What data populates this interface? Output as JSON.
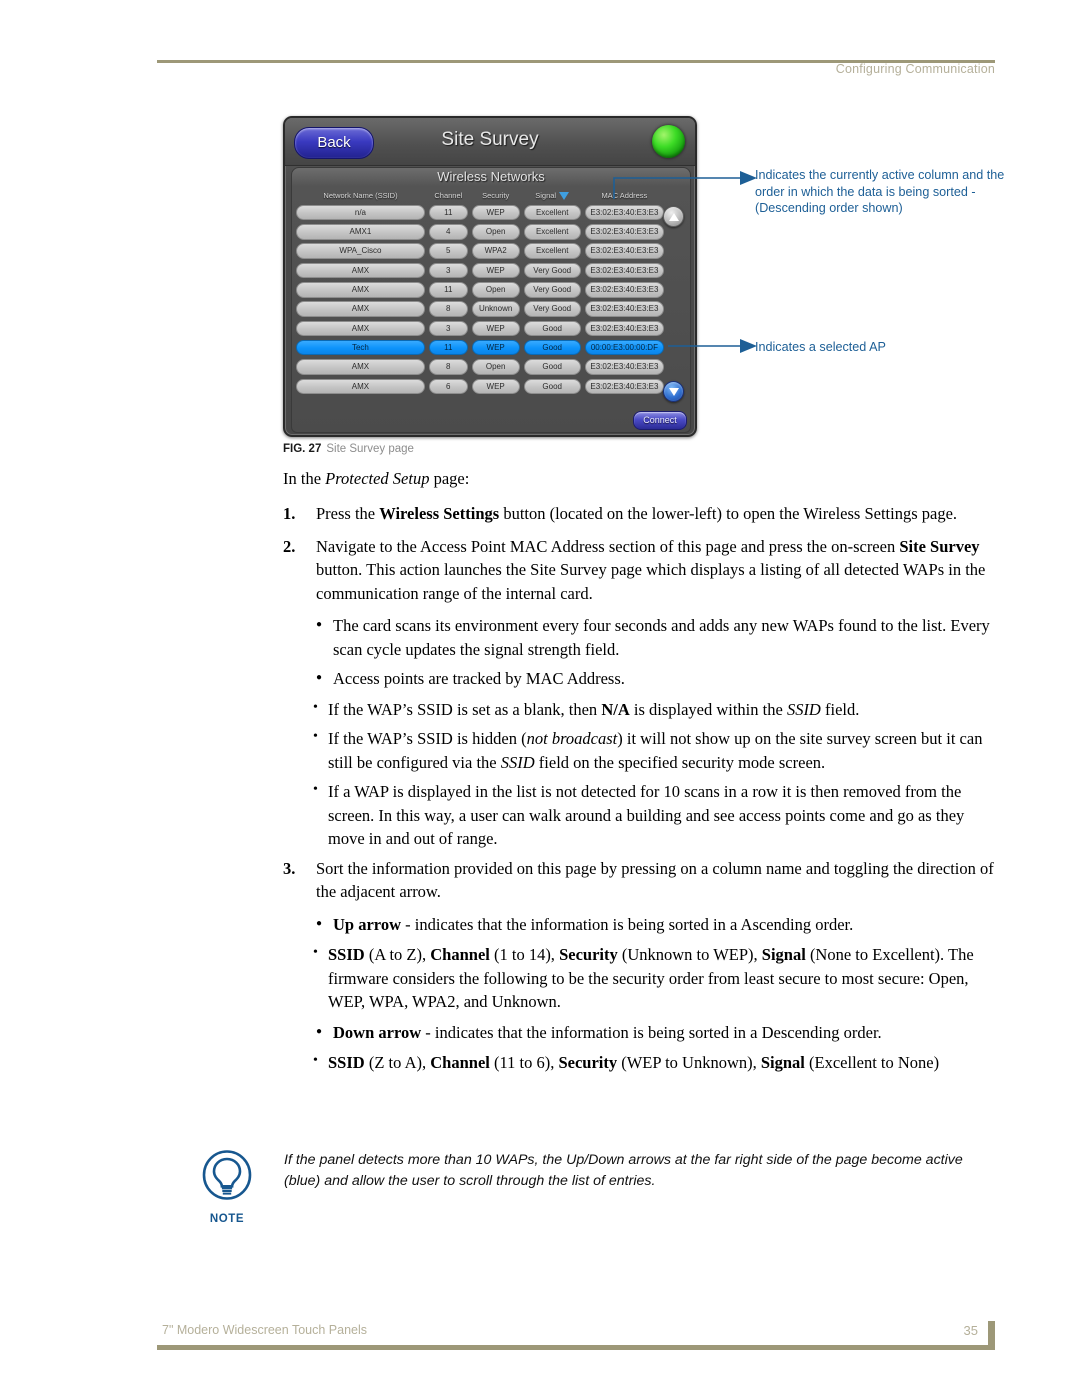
{
  "header": {
    "title": "Configuring Communication"
  },
  "figure": {
    "caption_label": "FIG. 27",
    "caption_text": "Site Survey page",
    "panel": {
      "back_label": "Back",
      "title": "Site Survey",
      "section_title": "Wireless Networks",
      "connect_label": "Connect",
      "status_led_color": "#3ddc26",
      "selected_row_color": "#0d93fb",
      "sort_column": "Signal",
      "sort_direction": "descending",
      "columns": [
        "Network Name (SSID)",
        "Channel",
        "Security",
        "Signal",
        "MAC Address"
      ],
      "rows": [
        {
          "ssid": "n/a",
          "channel": "11",
          "security": "WEP",
          "signal": "Excellent",
          "mac": "E3:02:E3:40:E3:E3",
          "selected": false
        },
        {
          "ssid": "AMX1",
          "channel": "4",
          "security": "Open",
          "signal": "Excellent",
          "mac": "E3:02:E3:40:E3:E3",
          "selected": false
        },
        {
          "ssid": "WPA_Cisco",
          "channel": "5",
          "security": "WPA2",
          "signal": "Excellent",
          "mac": "E3:02:E3:40:E3:E3",
          "selected": false
        },
        {
          "ssid": "AMX",
          "channel": "3",
          "security": "WEP",
          "signal": "Very Good",
          "mac": "E3:02:E3:40:E3:E3",
          "selected": false
        },
        {
          "ssid": "AMX",
          "channel": "11",
          "security": "Open",
          "signal": "Very Good",
          "mac": "E3:02:E3:40:E3:E3",
          "selected": false
        },
        {
          "ssid": "AMX",
          "channel": "8",
          "security": "Unknown",
          "signal": "Very Good",
          "mac": "E3:02:E3:40:E3:E3",
          "selected": false
        },
        {
          "ssid": "AMX",
          "channel": "3",
          "security": "WEP",
          "signal": "Good",
          "mac": "E3:02:E3:40:E3:E3",
          "selected": false
        },
        {
          "ssid": "Tech",
          "channel": "11",
          "security": "WEP",
          "signal": "Good",
          "mac": "00:00:E3:00:00:DF",
          "selected": true
        },
        {
          "ssid": "AMX",
          "channel": "8",
          "security": "Open",
          "signal": "Good",
          "mac": "E3:02:E3:40:E3:E3",
          "selected": false
        },
        {
          "ssid": "AMX",
          "channel": "6",
          "security": "WEP",
          "signal": "Good",
          "mac": "E3:02:E3:40:E3:E3",
          "selected": false
        }
      ]
    },
    "callouts": {
      "sort_indicator": "Indicates the currently active column and the order in which the data is being sorted - (Descending order shown)",
      "selected_ap": "Indicates a selected AP",
      "color": "#1d5f96"
    }
  },
  "body": {
    "lead_in_pre": "In the ",
    "lead_in_em": "Protected Setup",
    "lead_in_post": " page:",
    "steps": [
      {
        "num": "1.",
        "parts": [
          {
            "t": "Press the ",
            "s": "n"
          },
          {
            "t": "Wireless Settings",
            "s": "b"
          },
          {
            "t": " button (located on the lower-left) to open the Wireless Settings page.",
            "s": "n"
          }
        ]
      },
      {
        "num": "2.",
        "parts": [
          {
            "t": "Navigate to the Access Point MAC Address section of this page and press the on-screen ",
            "s": "n"
          },
          {
            "t": "Site Survey",
            "s": "b"
          },
          {
            "t": " button. This action launches the Site Survey page which displays a listing of all detected WAPs in the communication range of the internal card.",
            "s": "n"
          }
        ]
      }
    ],
    "step2_bullets": [
      {
        "parts": [
          {
            "t": "The card scans its environment every four seconds and adds any new WAPs found to the list. Every scan cycle updates the signal strength field.",
            "s": "n"
          }
        ]
      },
      {
        "parts": [
          {
            "t": "Access points are tracked by MAC Address.",
            "s": "n"
          }
        ]
      }
    ],
    "step2_subbullets": [
      {
        "parts": [
          {
            "t": "If the WAP’s SSID is set as a blank, then ",
            "s": "n"
          },
          {
            "t": "N/A",
            "s": "b"
          },
          {
            "t": " is displayed within the ",
            "s": "n"
          },
          {
            "t": "SSID",
            "s": "i"
          },
          {
            "t": " field.",
            "s": "n"
          }
        ]
      },
      {
        "parts": [
          {
            "t": "If the WAP’s SSID is hidden (",
            "s": "n"
          },
          {
            "t": "not broadcast",
            "s": "i"
          },
          {
            "t": ") it will not show up on the site survey screen but it can still be configured via the ",
            "s": "n"
          },
          {
            "t": "SSID",
            "s": "i"
          },
          {
            "t": " field on the specified security mode screen.",
            "s": "n"
          }
        ]
      },
      {
        "parts": [
          {
            "t": "If a WAP is displayed in the list is not detected for 10 scans in a row it is then removed from the screen. In this way, a user can walk around a building and see access points come and go as they move in and out of range.",
            "s": "n"
          }
        ]
      }
    ],
    "step3": {
      "num": "3.",
      "parts": [
        {
          "t": "Sort the information provided on this page by pressing on a column name and toggling the direction of the adjacent arrow.",
          "s": "n"
        }
      ]
    },
    "step3_bullets": [
      {
        "parts": [
          {
            "t": "Up arrow",
            "s": "b"
          },
          {
            "t": " - indicates that the information is being sorted in a Ascending order.",
            "s": "n"
          }
        ]
      }
    ],
    "step3_sub_a": [
      {
        "parts": [
          {
            "t": "SSID",
            "s": "b"
          },
          {
            "t": " (A to Z), ",
            "s": "n"
          },
          {
            "t": "Channel",
            "s": "b"
          },
          {
            "t": " (1 to 14), ",
            "s": "n"
          },
          {
            "t": "Security",
            "s": "b"
          },
          {
            "t": " (Unknown to WEP), ",
            "s": "n"
          },
          {
            "t": "Signal",
            "s": "b"
          },
          {
            "t": " (None to Excellent). The firmware considers the following to be the security order from least secure to most secure: Open, WEP, WPA, WPA2, and Unknown.",
            "s": "n"
          }
        ]
      }
    ],
    "step3_bullets_b": [
      {
        "parts": [
          {
            "t": "Down arrow",
            "s": "b"
          },
          {
            "t": " - indicates that the information is being sorted in a Descending order.",
            "s": "n"
          }
        ]
      }
    ],
    "step3_sub_b": [
      {
        "parts": [
          {
            "t": "SSID",
            "s": "b"
          },
          {
            "t": " (Z to A), ",
            "s": "n"
          },
          {
            "t": "Channel",
            "s": "b"
          },
          {
            "t": " (11 to 6), ",
            "s": "n"
          },
          {
            "t": "Security",
            "s": "b"
          },
          {
            "t": " (WEP to Unknown), ",
            "s": "n"
          },
          {
            "t": "Signal",
            "s": "b"
          },
          {
            "t": " (Excellent to None)",
            "s": "n"
          }
        ]
      }
    ]
  },
  "note": {
    "label": "NOTE",
    "text": "If the panel detects more than 10 WAPs, the Up/Down arrows at the far right side of the page become active (blue) and allow the user to scroll through the list of entries.",
    "color": "#17578f"
  },
  "footer": {
    "left": "7\" Modero Widescreen Touch Panels",
    "page": "35",
    "rule_color": "#9d9878"
  }
}
